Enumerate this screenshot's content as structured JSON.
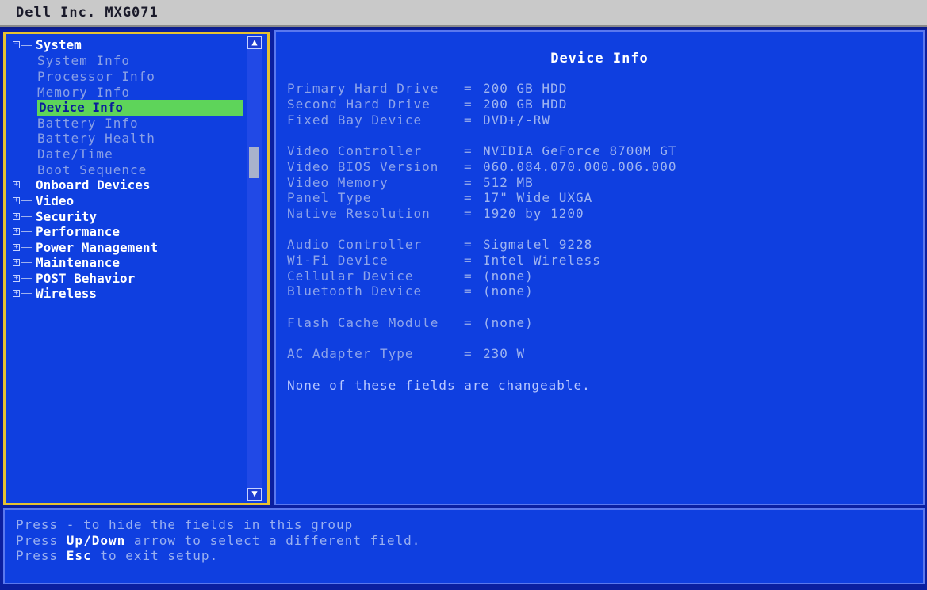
{
  "window": {
    "title": "Dell Inc. MXG071"
  },
  "tree": {
    "system_label": "System",
    "children": [
      {
        "label": "System Info",
        "selected": false
      },
      {
        "label": "Processor Info",
        "selected": false
      },
      {
        "label": "Memory Info",
        "selected": false
      },
      {
        "label": "Device Info",
        "selected": true
      },
      {
        "label": "Battery Info",
        "selected": false
      },
      {
        "label": "Battery Health",
        "selected": false
      },
      {
        "label": "Date/Time",
        "selected": false
      },
      {
        "label": "Boot Sequence",
        "selected": false
      }
    ],
    "groups": [
      "Onboard Devices",
      "Video",
      "Security",
      "Performance",
      "Power Management",
      "Maintenance",
      "POST Behavior",
      "Wireless"
    ]
  },
  "panel": {
    "title": "Device Info",
    "fields": [
      {
        "label": "Primary Hard Drive",
        "value": "200 GB HDD"
      },
      {
        "label": "Second Hard Drive",
        "value": "200 GB HDD"
      },
      {
        "label": "Fixed Bay Device",
        "value": "DVD+/-RW"
      },
      {
        "label": "Video Controller",
        "value": "NVIDIA GeForce 8700M GT"
      },
      {
        "label": "Video BIOS Version",
        "value": "060.084.070.000.006.000"
      },
      {
        "label": "Video Memory",
        "value": "512 MB"
      },
      {
        "label": "Panel Type",
        "value": "17\" Wide UXGA"
      },
      {
        "label": "Native Resolution",
        "value": "1920 by 1200"
      },
      {
        "label": "Audio Controller",
        "value": "Sigmatel 9228"
      },
      {
        "label": "Wi-Fi Device",
        "value": "Intel Wireless"
      },
      {
        "label": "Cellular Device",
        "value": "(none)"
      },
      {
        "label": "Bluetooth Device",
        "value": "(none)"
      },
      {
        "label": "Flash Cache Module",
        "value": "(none)"
      },
      {
        "label": "AC Adapter Type",
        "value": "230 W"
      }
    ],
    "note": "None of these fields are changeable."
  },
  "help": {
    "line1": "Press - to hide the fields in this group",
    "line2_pre": "Press ",
    "line2_key": "Up/Down",
    "line2_post": " arrow to select a different field.",
    "line3_pre": "Press ",
    "line3_key": "Esc",
    "line3_post": " to exit setup."
  },
  "scroll": {
    "up_icon": "▲",
    "down_icon": "▼"
  },
  "colors": {
    "background": "#0f3fe0",
    "selection": "#5ed45a",
    "title_bar": "#c9c9c9",
    "focus_border": "#e6c230"
  }
}
